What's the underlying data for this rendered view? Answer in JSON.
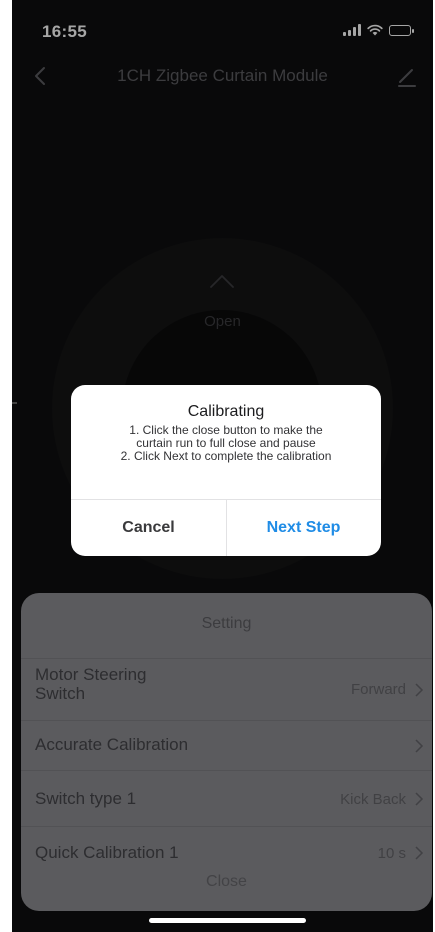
{
  "status_bar": {
    "time": "16:55"
  },
  "nav": {
    "title": "1CH Zigbee Curtain Module"
  },
  "control": {
    "open_label": "Open"
  },
  "dialog": {
    "title": "Calibrating",
    "lines": [
      "1. Click the close button to make the",
      "curtain run to full close and pause",
      "2. Click Next to complete the calibration"
    ],
    "cancel_label": "Cancel",
    "next_label": "Next Step",
    "accent_color": "#1f8ce6"
  },
  "sheet": {
    "title": "Setting",
    "rows": [
      {
        "label_line1": "Motor Steering",
        "label_line2": "Switch",
        "value": "Forward"
      },
      {
        "label": "Accurate Calibration",
        "value": ""
      },
      {
        "label": "Switch type 1",
        "value": "Kick Back"
      },
      {
        "label": "Quick Calibration 1",
        "value": "10 s"
      }
    ],
    "close_label": "Close"
  }
}
